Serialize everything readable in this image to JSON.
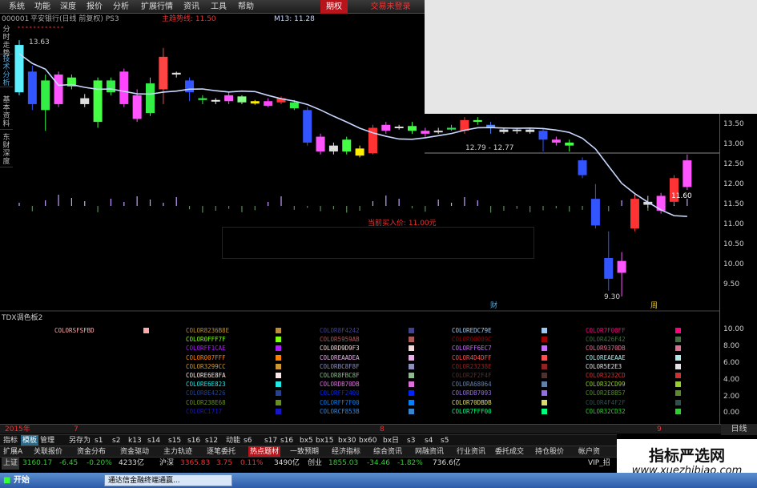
{
  "menu": {
    "items": [
      "系统",
      "功能",
      "深度",
      "报价",
      "分析",
      "扩展行情",
      "资讯",
      "工具",
      "帮助",
      "期权",
      "交易未登录"
    ]
  },
  "info": {
    "code": "000001",
    "name": "平安银行(日线 前复权) PS3",
    "indicator": "主趋势线: 11.50",
    "m13": "M13: 11.28"
  },
  "sidebar": {
    "tabs": [
      "分时走势",
      "技术分析",
      "基本资料",
      "东财深度"
    ]
  },
  "axis": {
    "upper_ticks": [
      "13.50",
      "13.00",
      "12.50",
      "12.00",
      "11.50",
      "11.00",
      "10.50",
      "10.00",
      "9.50"
    ],
    "lower_ticks": [
      "10.00",
      "8.00",
      "6.00",
      "4.00",
      "2.00",
      "0.00"
    ],
    "price_tag": "11.60"
  },
  "chart_annotations": {
    "high_label": "13.63",
    "range_label": "12.79 - 12.77",
    "low_label": "9.30",
    "buy_label": "当前买入价: 11.00元",
    "marker_cai": "财",
    "marker_zhou": "周"
  },
  "chart_data": {
    "type": "candlestick",
    "ylim": [
      9.3,
      13.7
    ],
    "candles": [
      {
        "o": 12.75,
        "c": 13.55,
        "h": 13.63,
        "l": 12.7,
        "color": "#5cf0ff"
      },
      {
        "o": 13.1,
        "c": 12.55,
        "h": 13.2,
        "l": 12.45,
        "color": "#3355ff"
      },
      {
        "o": 12.45,
        "c": 12.95,
        "h": 13.05,
        "l": 12.1,
        "color": "#33ee44"
      },
      {
        "o": 12.55,
        "c": 13.05,
        "h": 13.1,
        "l": 12.5,
        "color": "#ff55ff"
      },
      {
        "o": 12.85,
        "c": 13.0,
        "h": 13.05,
        "l": 12.8,
        "color": "#44ff44"
      },
      {
        "o": 12.55,
        "c": 12.65,
        "h": 12.72,
        "l": 12.5,
        "color": "#dddddd"
      },
      {
        "o": 12.95,
        "c": 12.25,
        "h": 13.0,
        "l": 12.15,
        "color": "#44ff44"
      },
      {
        "o": 12.75,
        "c": 12.95,
        "h": 13.0,
        "l": 12.7,
        "color": "#33ee44"
      },
      {
        "o": 12.55,
        "c": 13.1,
        "h": 13.15,
        "l": 12.5,
        "color": "#ff44ff"
      },
      {
        "o": 12.3,
        "c": 12.7,
        "h": 12.8,
        "l": 12.25,
        "color": "#ff55ff"
      },
      {
        "o": 12.4,
        "c": 12.9,
        "h": 13.0,
        "l": 12.35,
        "color": "#33ee44"
      },
      {
        "o": 12.8,
        "c": 13.35,
        "h": 13.5,
        "l": 12.55,
        "color": "#ff4444"
      },
      {
        "o": 13.05,
        "c": 13.08,
        "h": 13.1,
        "l": 13.0,
        "color": "#dddddd"
      },
      {
        "o": 12.95,
        "c": 12.75,
        "h": 13.0,
        "l": 12.6,
        "color": "#3355ff"
      },
      {
        "o": 12.65,
        "c": 12.62,
        "h": 12.7,
        "l": 12.55,
        "color": "#33ee44"
      },
      {
        "o": 12.62,
        "c": 12.6,
        "h": 12.65,
        "l": 12.55,
        "color": "#eeeeee"
      },
      {
        "o": 12.7,
        "c": 12.6,
        "h": 12.75,
        "l": 12.55,
        "color": "#ff55ff"
      },
      {
        "o": 12.68,
        "c": 12.58,
        "h": 12.7,
        "l": 12.55,
        "color": "#88ff88"
      },
      {
        "o": 12.6,
        "c": 12.56,
        "h": 12.62,
        "l": 12.54,
        "color": "#ffee00"
      },
      {
        "o": 12.52,
        "c": 12.6,
        "h": 12.65,
        "l": 12.5,
        "color": "#ff44ff"
      },
      {
        "o": 12.58,
        "c": 12.65,
        "h": 12.68,
        "l": 12.55,
        "color": "#ff3333"
      },
      {
        "o": 12.58,
        "c": 12.48,
        "h": 12.62,
        "l": 12.45,
        "color": "#33ee44"
      },
      {
        "o": 12.45,
        "c": 11.9,
        "h": 12.5,
        "l": 11.85,
        "color": "#3355ff"
      },
      {
        "o": 12.0,
        "c": 11.75,
        "h": 12.05,
        "l": 11.7,
        "color": "#ff55ff"
      },
      {
        "o": 11.85,
        "c": 11.75,
        "h": 11.9,
        "l": 11.7,
        "color": "#dddddd"
      },
      {
        "o": 11.95,
        "c": 11.75,
        "h": 12.0,
        "l": 11.7,
        "color": "#44ff44"
      },
      {
        "o": 11.8,
        "c": 11.68,
        "h": 11.85,
        "l": 11.65,
        "color": "#ffee00"
      },
      {
        "o": 11.72,
        "c": 12.15,
        "h": 12.2,
        "l": 11.7,
        "color": "#ff3333"
      },
      {
        "o": 12.1,
        "c": 12.2,
        "h": 12.25,
        "l": 12.05,
        "color": "#ff55ff"
      },
      {
        "o": 12.15,
        "c": 12.17,
        "h": 12.2,
        "l": 12.12,
        "color": "#dddddd"
      },
      {
        "o": 12.18,
        "c": 12.1,
        "h": 12.25,
        "l": 12.05,
        "color": "#44ff44"
      },
      {
        "o": 12.1,
        "c": 12.05,
        "h": 12.15,
        "l": 12.0,
        "color": "#ff55ff"
      },
      {
        "o": 12.08,
        "c": 12.1,
        "h": 12.15,
        "l": 12.05,
        "color": "#dddddd"
      },
      {
        "o": 12.12,
        "c": 12.15,
        "h": 12.2,
        "l": 12.1,
        "color": "#33dd55"
      },
      {
        "o": 12.1,
        "c": 12.28,
        "h": 12.33,
        "l": 12.05,
        "color": "#ff3333"
      },
      {
        "o": 12.25,
        "c": 12.28,
        "h": 12.33,
        "l": 12.2,
        "color": "#44ff44"
      },
      {
        "o": 12.2,
        "c": 12.15,
        "h": 12.25,
        "l": 12.05,
        "color": "#5588ff"
      },
      {
        "o": 12.12,
        "c": 12.08,
        "h": 12.15,
        "l": 12.05,
        "color": "#dddddd"
      },
      {
        "o": 12.12,
        "c": 12.1,
        "h": 12.15,
        "l": 12.05,
        "color": "#dddddd"
      },
      {
        "o": 12.12,
        "c": 12.08,
        "h": 12.15,
        "l": 12.05,
        "color": "#dddddd"
      },
      {
        "o": 12.1,
        "c": 11.95,
        "h": 12.15,
        "l": 11.75,
        "color": "#3355ff"
      },
      {
        "o": 11.95,
        "c": 11.9,
        "h": 12.0,
        "l": 11.85,
        "color": "#ff55ff"
      },
      {
        "o": 11.9,
        "c": 11.85,
        "h": 11.95,
        "l": 11.75,
        "color": "#44ff44"
      },
      {
        "o": 11.6,
        "c": 11.35,
        "h": 11.65,
        "l": 11.3,
        "color": "#3355ff"
      },
      {
        "o": 10.95,
        "c": 10.5,
        "h": 11.2,
        "l": 10.45,
        "color": "#3355ff"
      },
      {
        "o": 9.95,
        "c": 9.6,
        "h": 10.4,
        "l": 9.4,
        "color": "#3355ff"
      },
      {
        "o": 9.7,
        "c": 9.9,
        "h": 10.05,
        "l": 9.3,
        "color": "#ff55ff"
      },
      {
        "o": 10.45,
        "c": 10.95,
        "h": 11.0,
        "l": 10.4,
        "color": "#ff3333"
      },
      {
        "o": 10.9,
        "c": 10.85,
        "h": 11.0,
        "l": 10.8,
        "color": "#dddddd"
      },
      {
        "o": 10.75,
        "c": 11.0,
        "h": 11.05,
        "l": 10.7,
        "color": "#ff55ff"
      },
      {
        "o": 10.9,
        "c": 11.3,
        "h": 11.35,
        "l": 10.85,
        "color": "#ff3333"
      },
      {
        "o": 11.15,
        "c": 11.6,
        "h": 11.7,
        "l": 11.1,
        "color": "#ff55ff"
      }
    ]
  },
  "panel": {
    "title": "TDX调色板2",
    "colors": [
      {
        "name": "COLORSFSFBD",
        "hex": "#ffaaaa"
      },
      {
        "name": "COLOR8236B8E",
        "hex": "#b88e36"
      },
      {
        "name": "COLOR0FFF7F",
        "hex": "#7fff0f"
      },
      {
        "name": "COLORFF1CAE",
        "hex": "#ae1cff"
      },
      {
        "name": "COLOR007FFF",
        "hex": "#ff7f00"
      },
      {
        "name": "COLOR3299CC",
        "hex": "#cc9932"
      },
      {
        "name": "COLORE6E8FA",
        "hex": "#fae8e6"
      },
      {
        "name": "COLORE6E823",
        "hex": "#23e8e6"
      },
      {
        "name": "COLOR8E4226",
        "hex": "#26428e"
      },
      {
        "name": "COLOR238E68",
        "hex": "#688e23"
      },
      {
        "name": "COLORC1717",
        "hex": "#1717c1"
      },
      {
        "name": "COLOR8F4242",
        "hex": "#42428f"
      },
      {
        "name": "COLOR5959AB",
        "hex": "#ab5959"
      },
      {
        "name": "COLORD9D9F3",
        "hex": "#f3d9d9"
      },
      {
        "name": "COLOREAADEA",
        "hex": "#eaadea"
      },
      {
        "name": "COLORBC8F8F",
        "hex": "#8f8fbc"
      },
      {
        "name": "COLOR8FBC8F",
        "hex": "#8fbc8f"
      },
      {
        "name": "COLORDB70DB",
        "hex": "#db70db"
      },
      {
        "name": "COLORFF2400",
        "hex": "#0024ff"
      },
      {
        "name": "COLORFF7F00",
        "hex": "#007fff"
      },
      {
        "name": "COLORCF853B",
        "hex": "#3b85cf"
      },
      {
        "name": "COLOREDC79E",
        "hex": "#9ec7ed"
      },
      {
        "name": "COLOR00009C",
        "hex": "#9c0000"
      },
      {
        "name": "COLORFF6EC7",
        "hex": "#c76eff"
      },
      {
        "name": "COLOR4D4DFF",
        "hex": "#ff4d4d"
      },
      {
        "name": "COLOR23238E",
        "hex": "#8e2323"
      },
      {
        "name": "COLOR2F2F4F",
        "hex": "#4f2f2f"
      },
      {
        "name": "COLORA68064",
        "hex": "#6480a6"
      },
      {
        "name": "COLORDB7093",
        "hex": "#9370db"
      },
      {
        "name": "COLOR70DBDB",
        "hex": "#dbdb70"
      },
      {
        "name": "COLOR7FFF00",
        "hex": "#00ff7f"
      },
      {
        "name": "COLOR7F00FF",
        "hex": "#ff007f"
      },
      {
        "name": "COLOR426F42",
        "hex": "#426f42"
      },
      {
        "name": "COLOR9370DB",
        "hex": "#db7093"
      },
      {
        "name": "COLOREAEAAE",
        "hex": "#aeeaea"
      },
      {
        "name": "COLOR5E2E3",
        "hex": "#e3e2e5"
      },
      {
        "name": "COLOR3232CD",
        "hex": "#cd3232"
      },
      {
        "name": "COLOR32CD99",
        "hex": "#99cd32"
      },
      {
        "name": "COLOR2E8B57",
        "hex": "#578b2e"
      },
      {
        "name": "COLOR4F4F2F",
        "hex": "#2f4f4f"
      },
      {
        "name": "COLOR32CD32",
        "hex": "#32cd32"
      }
    ]
  },
  "datebar": {
    "year": "2015年",
    "m1": "7",
    "m2": "8",
    "m3": "9"
  },
  "rightbtn": "日线",
  "funcbar": [
    "指标",
    "模板",
    "管理",
    "另存为",
    "s1",
    "s2",
    "k13",
    "s14",
    "s15",
    "s16",
    "s12",
    "动能",
    "s6",
    "s17",
    "s16",
    "bx5",
    "bx15",
    "bx30",
    "bx60",
    "bx日",
    "s3",
    "s4",
    "s5"
  ],
  "tabsbar": [
    "扩展A",
    "关联报价",
    "资金分布",
    "资金驱动",
    "主力轨迹",
    "逐笔委托",
    "热点题材",
    "一致预期",
    "经济指标",
    "综合资讯",
    "网融资讯",
    "行业资讯",
    "委托成交",
    "持仓股价",
    "帐户资"
  ],
  "status": {
    "sh_label": "上证",
    "sh_val": "3160.17",
    "sh_chg": "-6.45",
    "sh_pct": "-0.20%",
    "sh_amt": "4233亿",
    "sz_label": "沪深",
    "sz_val": "3365.83",
    "sz_chg": "3.75",
    "sz_pct": "0.11%",
    "sz_amt": "3490亿",
    "cy_label": "创业",
    "cy_val": "1855.03",
    "cy_chg": "-34.46",
    "cy_pct": "-1.82%",
    "cy_amt": "736.6亿",
    "vip": "VIP_招"
  },
  "taskbar": {
    "start": "开始",
    "item": "通达信金融终端通赢..."
  },
  "watermark": {
    "line1": "指标严选网",
    "line2": "www.xuezhibiao.com"
  },
  "colors": {
    "background": "#000000",
    "ma_line": "#c8d8ff",
    "up": "#ff3333",
    "down": "#3355ff",
    "accent": "#b8141c"
  }
}
